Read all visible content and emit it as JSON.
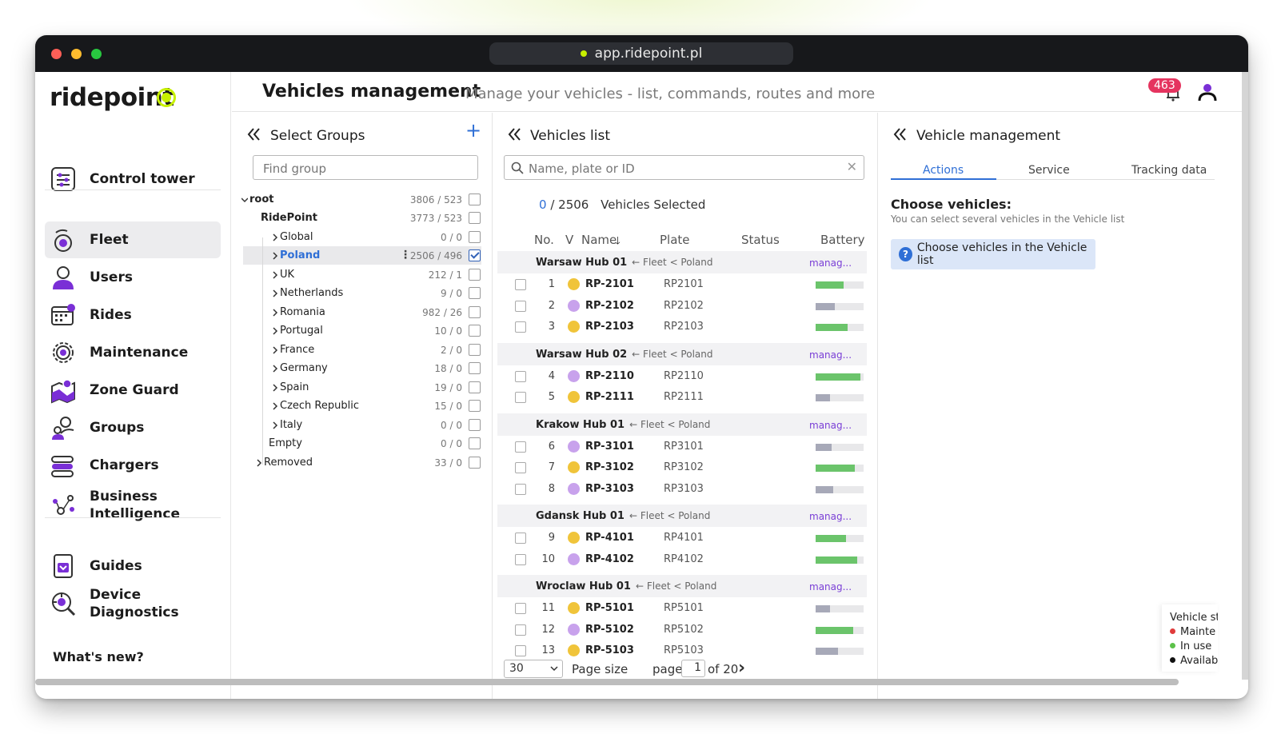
{
  "browser": {
    "url": "app.ridepoint.pl"
  },
  "brand": {
    "name": "ridepoint",
    "accent": "#c7f000",
    "primary": "#2f6fd6"
  },
  "sidebar": {
    "items": [
      {
        "label": "Control tower",
        "icon": "control-tower-icon"
      },
      {
        "label": "Fleet",
        "icon": "scooter-icon",
        "active": true
      },
      {
        "label": "Users",
        "icon": "user-icon"
      },
      {
        "label": "Rides",
        "icon": "calendar-icon"
      },
      {
        "label": "Maintenance",
        "icon": "gear-icon"
      },
      {
        "label": "Zone Guard",
        "icon": "map-pin-icon"
      },
      {
        "label": "Groups",
        "icon": "group-icon"
      },
      {
        "label": "Chargers",
        "icon": "charger-icon"
      },
      {
        "label": "Business Intelligence",
        "icon": "network-icon"
      },
      {
        "label": "Guides",
        "icon": "book-icon"
      },
      {
        "label": "Device Diagnostics",
        "icon": "diagnostics-icon"
      }
    ],
    "whats_new": "What's new?"
  },
  "header": {
    "title": "Vehicles management",
    "subtitle": "Manage your vehicles - list, commands, routes and more",
    "notifications": "463"
  },
  "groups_panel": {
    "title": "Select Groups",
    "add": "+",
    "search_placeholder": "Find group",
    "rows": [
      {
        "name": "root",
        "count": "3806 / 523"
      },
      {
        "name": "RidePoint",
        "count": "3773 / 523"
      },
      {
        "name": "Global",
        "count": "0 / 0"
      },
      {
        "name": "Poland",
        "count": "2506 / 496",
        "checked": true
      },
      {
        "name": "UK",
        "count": "212 / 1"
      },
      {
        "name": "Netherlands",
        "count": "9 / 0"
      },
      {
        "name": "Romania",
        "count": "982 / 26"
      },
      {
        "name": "Portugal",
        "count": "10 / 0"
      },
      {
        "name": "France",
        "count": "2 / 0"
      },
      {
        "name": "Germany",
        "count": "18 / 0"
      },
      {
        "name": "Spain",
        "count": "19 / 0"
      },
      {
        "name": "Czech Republic",
        "count": "15 / 0"
      },
      {
        "name": "Italy",
        "count": "0 / 0"
      },
      {
        "name": "Empty",
        "count": "0 / 0"
      },
      {
        "name": "Removed",
        "count": "33 / 0"
      }
    ]
  },
  "vehicles_panel": {
    "title": "Vehicles list",
    "search_placeholder": "Name, plate or ID",
    "clear": "✕",
    "selected_count": "0",
    "selected_total": "/ 2506",
    "selected_label": "Vehicles Selected",
    "columns": [
      "No.",
      "V",
      "Name",
      "Plate",
      "Status",
      "Battery"
    ],
    "sort_arrow": "🡓",
    "groups": [
      {
        "name": "Warsaw Hub 01",
        "path": "← Fleet < Poland",
        "link": "manag...",
        "vehicles": [
          {
            "no": "1",
            "name": "RP-2101",
            "plate": "RP2101",
            "color": "#f0c43a",
            "battery": 0.58
          },
          {
            "no": "2",
            "name": "RP-2102",
            "plate": "RP2102",
            "color": "#c8a2ec",
            "battery": 0.4
          },
          {
            "no": "3",
            "name": "RP-2103",
            "plate": "RP2103",
            "color": "#f0c43a",
            "battery": 0.66
          }
        ]
      },
      {
        "name": "Warsaw Hub 02",
        "path": "← Fleet < Poland",
        "link": "manag...",
        "vehicles": [
          {
            "no": "4",
            "name": "RP-2110",
            "plate": "RP2110",
            "color": "#c8a2ec",
            "battery": 0.93
          },
          {
            "no": "5",
            "name": "RP-2111",
            "plate": "RP2111",
            "color": "#f0c43a",
            "battery": 0.3
          }
        ]
      },
      {
        "name": "Krakow Hub 01",
        "path": "← Fleet < Poland",
        "link": "manag...",
        "vehicles": [
          {
            "no": "6",
            "name": "RP-3101",
            "plate": "RP3101",
            "color": "#c8a2ec",
            "battery": 0.33
          },
          {
            "no": "7",
            "name": "RP-3102",
            "plate": "RP3102",
            "color": "#f0c43a",
            "battery": 0.82
          },
          {
            "no": "8",
            "name": "RP-3103",
            "plate": "RP3103",
            "color": "#c8a2ec",
            "battery": 0.36
          }
        ]
      },
      {
        "name": "Gdansk Hub 01",
        "path": "← Fleet < Poland",
        "link": "manag...",
        "vehicles": [
          {
            "no": "9",
            "name": "RP-4101",
            "plate": "RP4101",
            "color": "#f0c43a",
            "battery": 0.63
          },
          {
            "no": "10",
            "name": "RP-4102",
            "plate": "RP4102",
            "color": "#c8a2ec",
            "battery": 0.86
          }
        ]
      },
      {
        "name": "Wroclaw Hub 01",
        "path": "← Fleet < Poland",
        "link": "manag...",
        "vehicles": [
          {
            "no": "11",
            "name": "RP-5101",
            "plate": "RP5101",
            "color": "#f0c43a",
            "battery": 0.3
          },
          {
            "no": "12",
            "name": "RP-5102",
            "plate": "RP5102",
            "color": "#c8a2ec",
            "battery": 0.78
          },
          {
            "no": "13",
            "name": "RP-5103",
            "plate": "RP5103",
            "color": "#f0c43a",
            "battery": 0.46
          }
        ]
      }
    ],
    "pager": {
      "size": "30",
      "size_label": "Page size",
      "page_label": "page",
      "page": "1",
      "of": "of 20",
      "next": "›"
    }
  },
  "management_panel": {
    "title": "Vehicle management",
    "tabs": [
      "Actions",
      "Service",
      "Tracking data"
    ],
    "choose_title": "Choose vehicles:",
    "choose_sub": "You can select several vehicles in the Vehicle list",
    "choose_box": "Choose vehicles in the Vehicle list"
  },
  "legend": {
    "title": "Vehicle st",
    "items": [
      {
        "label": "Mainte",
        "color": "#e03b3b"
      },
      {
        "label": "In use",
        "color": "#5cc14a"
      },
      {
        "label": "Availab",
        "color": "#111111"
      }
    ]
  }
}
